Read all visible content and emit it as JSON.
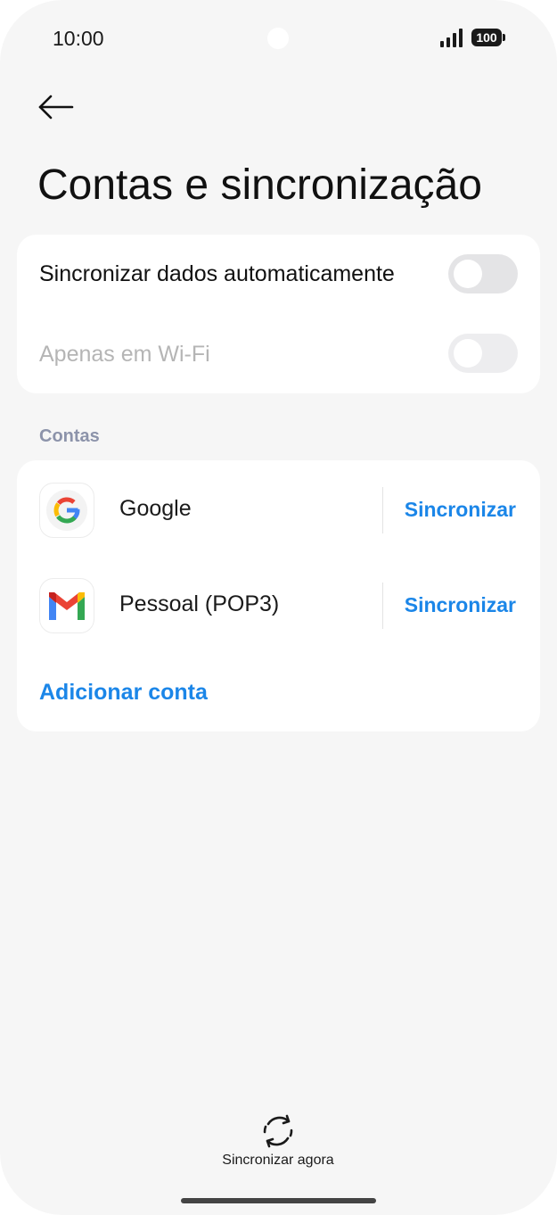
{
  "status_bar": {
    "time": "10:00",
    "battery": "100"
  },
  "header": {
    "back_icon": "arrow-left-icon",
    "title": "Contas e sincronização"
  },
  "sync_settings": {
    "auto_sync_label": "Sincronizar dados automaticamente",
    "auto_sync_enabled": false,
    "wifi_only_label": "Apenas em Wi-Fi",
    "wifi_only_enabled": false,
    "wifi_only_disabled": true
  },
  "accounts_section": {
    "label": "Contas",
    "items": [
      {
        "name": "Google",
        "icon": "google-icon",
        "action": "Sincronizar"
      },
      {
        "name": "Pessoal (POP3)",
        "icon": "gmail-icon",
        "action": "Sincronizar"
      }
    ],
    "add_account": "Adicionar conta"
  },
  "footer": {
    "sync_now_icon": "sync-icon",
    "sync_now_label": "Sincronizar agora"
  },
  "colors": {
    "accent": "#1b86e8",
    "background": "#f6f6f6",
    "section_label": "#8c93aa",
    "disabled_text": "#b5b5b5"
  }
}
